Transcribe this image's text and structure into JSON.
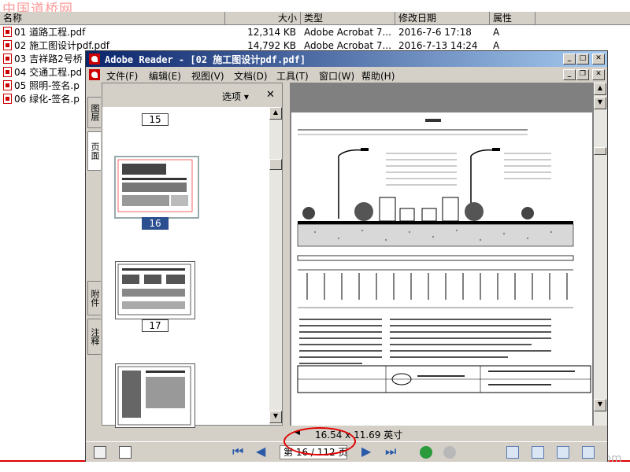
{
  "explorer": {
    "watermark": "中国道桥网",
    "columns": {
      "name": "名称",
      "size": "大小",
      "type": "类型",
      "modified": "修改日期",
      "attr": "属性"
    },
    "files": [
      {
        "name": "01 道路工程.pdf",
        "size": "12,314 KB",
        "type": "Adobe Acrobat 7...",
        "modified": "2016-7-6 17:18",
        "attr": "A"
      },
      {
        "name": "02 施工图设计pdf.pdf",
        "size": "14,792 KB",
        "type": "Adobe Acrobat 7...",
        "modified": "2016-7-13 14:24",
        "attr": "A"
      },
      {
        "name": "03 吉祥路2号桥",
        "size": "",
        "type": "",
        "modified": "",
        "attr": ""
      },
      {
        "name": "04 交通工程.pd",
        "size": "",
        "type": "",
        "modified": "",
        "attr": ""
      },
      {
        "name": "05 照明-签名.p",
        "size": "",
        "type": "",
        "modified": "",
        "attr": ""
      },
      {
        "name": "06 绿化-签名.p",
        "size": "",
        "type": "",
        "modified": "",
        "attr": ""
      }
    ],
    "site_watermark": "www.cnddo.com"
  },
  "reader": {
    "title": "Adobe Reader - [02 施工图设计pdf.pdf]",
    "menus": [
      "文件(F)",
      "编辑(E)",
      "视图(V)",
      "文档(D)",
      "工具(T)",
      "窗口(W)",
      "帮助(H)"
    ],
    "side_tabs": {
      "layers": "图层",
      "pages": "页面",
      "attachments": "附件",
      "comments": "注释"
    },
    "panel": {
      "options": "选项 ▾",
      "close": "✕"
    },
    "thumbnails": [
      "15",
      "16",
      "17"
    ],
    "selected_page": "16",
    "page_size": "16.54 x 11.69 英寸",
    "page_indicator": "第 16 / 112 页",
    "colors": {
      "title_start": "#0a246a",
      "title_end": "#a6caf0",
      "highlight": "#e00000",
      "selected": "#2c4f8f"
    }
  }
}
